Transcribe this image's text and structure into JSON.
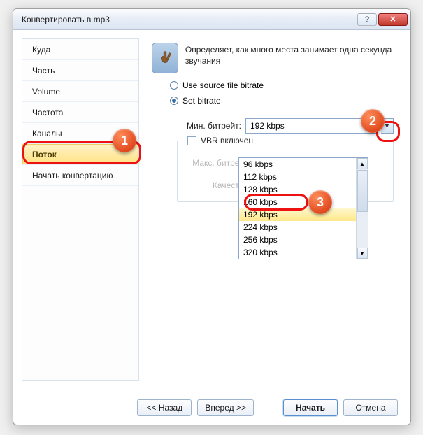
{
  "window": {
    "title": "Конвертировать в mp3"
  },
  "sidebar": {
    "items": [
      {
        "label": "Куда"
      },
      {
        "label": "Часть"
      },
      {
        "label": "Volume"
      },
      {
        "label": "Частота"
      },
      {
        "label": "Каналы"
      },
      {
        "label": "Поток"
      },
      {
        "label": "Начать конвертацию"
      }
    ]
  },
  "main": {
    "description": "Определяет, как много места занимает одна секунда звучания",
    "radio_source": "Use source file bitrate",
    "radio_set": "Set bitrate",
    "min_bitrate_label": "Мин. битрейт:",
    "min_bitrate_value": "192 kbps",
    "vbr_label": "VBR включен",
    "max_bitrate_label": "Макс. битрейт:",
    "quality_label": "Качество:",
    "dropdown": [
      "96 kbps",
      "112 kbps",
      "128 kbps",
      "160 kbps",
      "192 kbps",
      "224 kbps",
      "256 kbps",
      "320 kbps"
    ]
  },
  "footer": {
    "back": "<< Назад",
    "forward": "Вперед >>",
    "start": "Начать",
    "cancel": "Отмена"
  },
  "badges": {
    "b1": "1",
    "b2": "2",
    "b3": "3"
  }
}
